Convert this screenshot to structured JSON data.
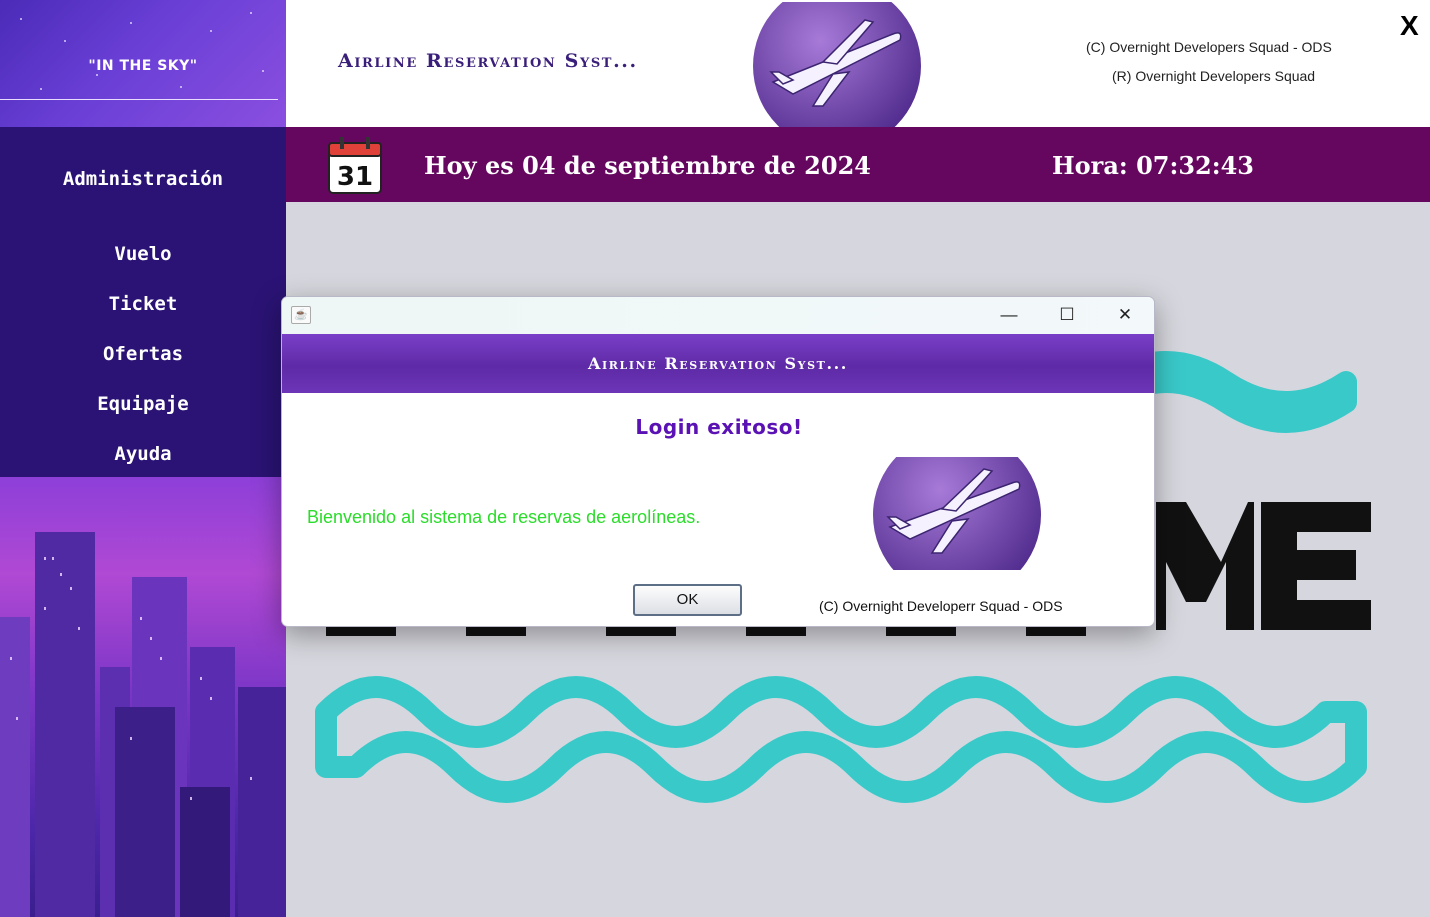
{
  "sidebar": {
    "brand": "\"IN THE SKY\"",
    "items": [
      {
        "label": "Administración"
      },
      {
        "label": "Vuelo"
      },
      {
        "label": "Ticket"
      },
      {
        "label": "Ofertas"
      },
      {
        "label": "Equipaje"
      },
      {
        "label": "Ayuda"
      }
    ]
  },
  "header": {
    "title": "Airline Reservation Syst...",
    "copyright_line1": "(C) Overnight Developers Squad - ODS",
    "copyright_line2": "(R) Overnight Developers Squad",
    "close_label": "X"
  },
  "datebar": {
    "calendar_day": "31",
    "date_text": "Hoy es 04 de septiembre de 2024",
    "time_text": "Hora: 07:32:43"
  },
  "dialog": {
    "window_controls": {
      "minimize": "—",
      "maximize": "☐",
      "close": "✕"
    },
    "banner_title": "Airline Reservation Syst...",
    "heading": "Login exitoso!",
    "message": "Bienvenido al sistema de reservas de aerolíneas.",
    "ok_label": "OK",
    "copyright": "(C) Overnight Developerr Squad - ODS"
  },
  "colors": {
    "sidebar_menu_bg": "#2a1374",
    "datebar_bg": "#65075f",
    "heading_purple": "#5b12b4",
    "message_green": "#2bdc2b",
    "wave_teal": "#3ac9c9"
  },
  "icons": {
    "calendar": "calendar-icon",
    "logo": "airplane-logo-icon",
    "java": "java-app-icon"
  }
}
